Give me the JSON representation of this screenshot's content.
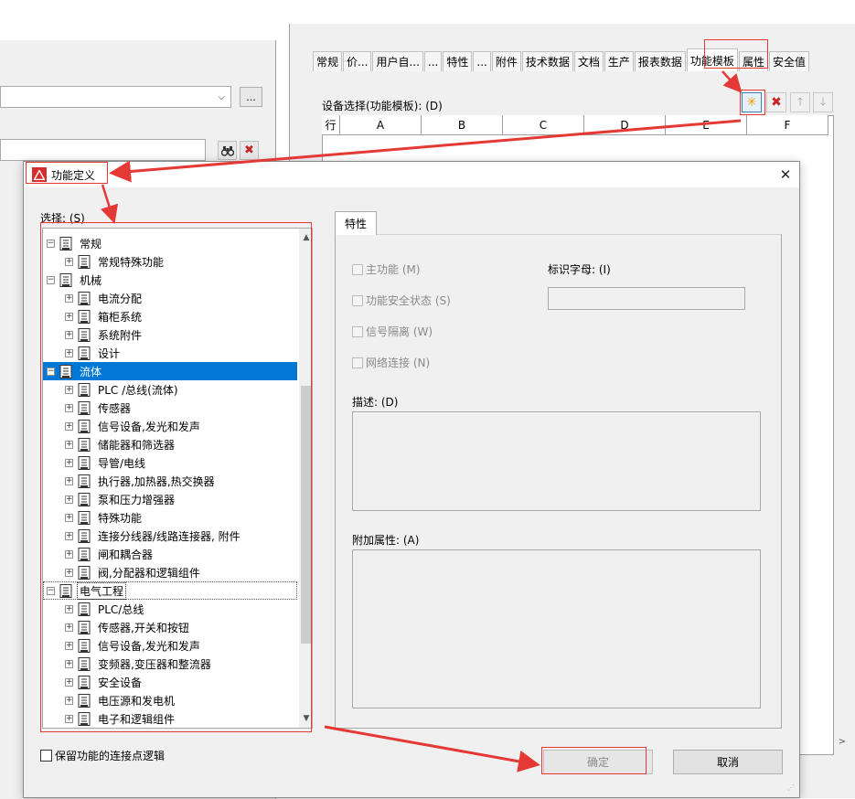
{
  "background": {
    "tabs": [
      "常规",
      "价...",
      "用户自...",
      "...",
      "特性",
      "...",
      "附件",
      "技术数据",
      "文档",
      "生产",
      "报表数据",
      "功能模板",
      "属性",
      "安全值"
    ],
    "active_tab": "功能模板",
    "equipment_label": "设备选择(功能模板): (D)",
    "grid_columns": [
      "行",
      "A",
      "B",
      "C",
      "D",
      "E",
      "F"
    ],
    "ellipsis_label": "...",
    "combo_arrow": "⌵",
    "find_icon_glyph": "🔍",
    "delete_glyph": "✖",
    "new_glyph": "✳",
    "up_glyph": "🡑",
    "down_glyph": "🡓",
    "hscroll_right": ">"
  },
  "dialog": {
    "title": "功能定义",
    "close_glyph": "✕",
    "selection_label": "选择: (S)",
    "tree": [
      {
        "level": 0,
        "label": "常规"
      },
      {
        "level": 1,
        "label": "常规特殊功能"
      },
      {
        "level": 0,
        "label": "机械"
      },
      {
        "level": 1,
        "label": "电流分配"
      },
      {
        "level": 1,
        "label": "箱柜系统"
      },
      {
        "level": 1,
        "label": "系统附件"
      },
      {
        "level": 1,
        "label": "设计"
      },
      {
        "level": 0,
        "label": "流体",
        "selected": true
      },
      {
        "level": 1,
        "label": "PLC /总线(流体)"
      },
      {
        "level": 1,
        "label": "传感器"
      },
      {
        "level": 1,
        "label": "信号设备,发光和发声"
      },
      {
        "level": 1,
        "label": "储能器和筛选器"
      },
      {
        "level": 1,
        "label": "导管/电线"
      },
      {
        "level": 1,
        "label": "执行器,加热器,热交换器"
      },
      {
        "level": 1,
        "label": "泵和压力增强器"
      },
      {
        "level": 1,
        "label": "特殊功能"
      },
      {
        "level": 1,
        "label": "连接分线器/线路连接器, 附件"
      },
      {
        "level": 1,
        "label": "闸和耦合器"
      },
      {
        "level": 1,
        "label": "阀,分配器和逻辑组件"
      },
      {
        "level": 0,
        "label": "电气工程",
        "focused": true
      },
      {
        "level": 1,
        "label": "PLC/总线"
      },
      {
        "level": 1,
        "label": "传感器,开关和按钮"
      },
      {
        "level": 1,
        "label": "信号设备,发光和发声"
      },
      {
        "level": 1,
        "label": "变频器,变压器和整流器"
      },
      {
        "level": 1,
        "label": "安全设备"
      },
      {
        "level": 1,
        "label": "电压源和发电机"
      },
      {
        "level": 1,
        "label": "电子和逻辑组件"
      }
    ],
    "properties_tab": "特性",
    "checkboxes": {
      "main_function": "主功能 (M)",
      "functional_safety": "功能安全状态 (S)",
      "signal_isolation": "信号隔离 (W)",
      "network_connection": "网络连接 (N)"
    },
    "identifier_label": "标识字母: (I)",
    "identifier_value": "",
    "description_label": "描述: (D)",
    "extra_props_label": "附加属性: (A)",
    "keep_logic_label": "保留功能的连接点逻辑",
    "ok_label": "确定",
    "cancel_label": "取消",
    "scroll_up": "▲",
    "scroll_down": "▼"
  },
  "colors": {
    "selection": "#0078d7",
    "annotation": "#e53935",
    "disabled_text": "#8a8a8a"
  }
}
